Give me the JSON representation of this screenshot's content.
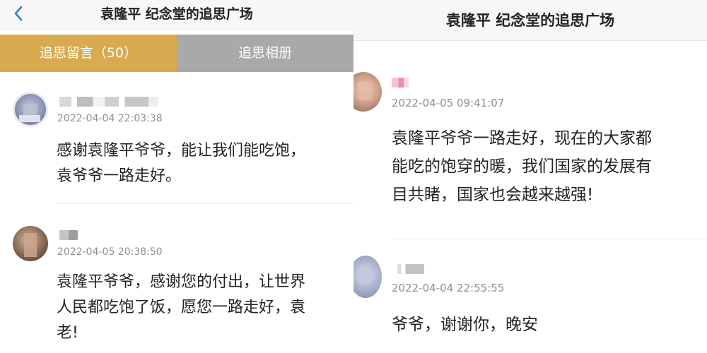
{
  "left_panel": {
    "title": "袁隆平 纪念堂的追思广场",
    "tabs": [
      {
        "label": "追思留言（50）",
        "active": true
      },
      {
        "label": "追思相册",
        "active": false
      }
    ],
    "comments": [
      {
        "timestamp": "2022-04-04 22:03:38",
        "message_lines": [
          "感谢袁隆平爷爷，能让我们能吃饱，",
          "袁爷爷一路走好。"
        ]
      },
      {
        "timestamp": "2022-04-05 20:38:50",
        "message_lines": [
          "袁隆平爷爷，感谢您的付出，让世界",
          "人民都吃饱了饭，愿您一路走好，袁",
          "老!"
        ]
      }
    ]
  },
  "right_panel": {
    "title": "袁隆平 纪念堂的追思广场",
    "comments": [
      {
        "timestamp": "2022-04-05 09:41:07",
        "message_lines": [
          "袁隆平爷爷一路走好，现在的大家都",
          "能吃的饱穿的暖，我们国家的发展有",
          "目共睹，国家也会越来越强!"
        ]
      },
      {
        "timestamp": "2022-04-04 22:55:55",
        "message_lines": [
          "爷爷，谢谢你，晚安"
        ]
      }
    ]
  },
  "colors": {
    "tab_active": "#d9aa4f",
    "tab_inactive": "#a9a9a9",
    "back_icon": "#2f7fd8",
    "timestamp": "#8f8f8f"
  },
  "icons": [
    "back-arrow-icon"
  ]
}
